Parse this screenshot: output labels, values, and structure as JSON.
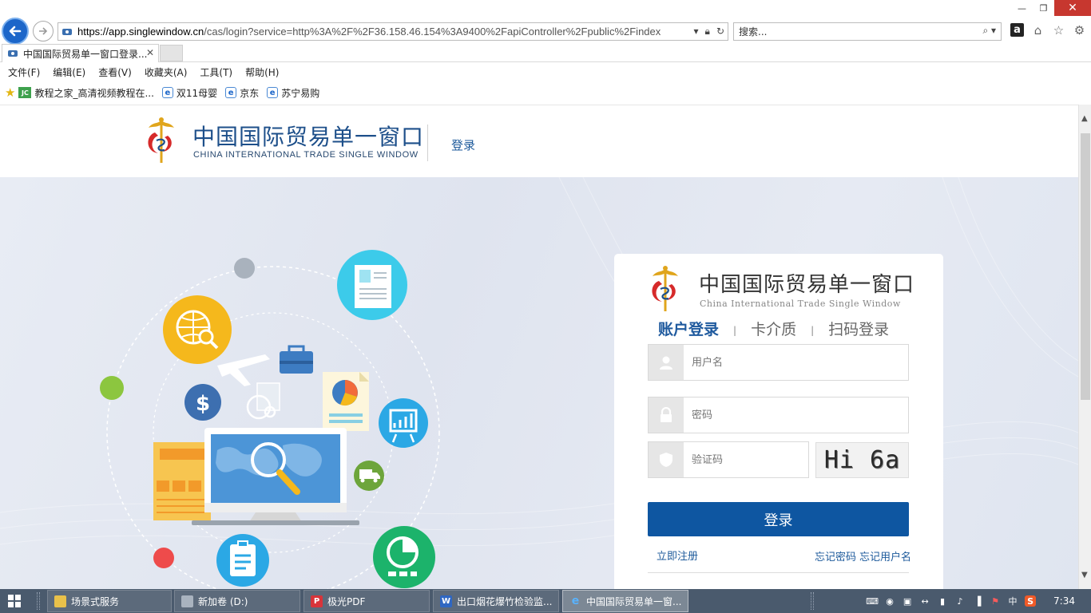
{
  "browser": {
    "url_host": "https://app.singlewindow.cn",
    "url_rest": "/cas/login?service=http%3A%2F%2F36.158.46.154%3A9400%2FapiController%2Fpublic%2Findex",
    "search_placeholder": "搜索...",
    "tab_title": "中国国际贸易单一窗口登录...",
    "menu": [
      "文件(F)",
      "编辑(E)",
      "查看(V)",
      "收藏夹(A)",
      "工具(T)",
      "帮助(H)"
    ],
    "favorites": [
      {
        "label": "教程之家_高清视频教程在...",
        "icon": "jc-icon"
      },
      {
        "label": "双11母婴",
        "icon": "ie-page-icon"
      },
      {
        "label": "京东",
        "icon": "ie-page-icon"
      },
      {
        "label": "苏宁易购",
        "icon": "ie-page-icon"
      }
    ]
  },
  "header": {
    "logo_cn": "中国国际贸易单一窗口",
    "logo_en": "CHINA INTERNATIONAL TRADE SINGLE WINDOW",
    "login_link": "登录"
  },
  "panel": {
    "logo_cn": "中国国际贸易单一窗口",
    "logo_en": "China International Trade Single Window",
    "tabs": [
      {
        "label": "账户登录",
        "active": true
      },
      {
        "label": "卡介质",
        "active": false
      },
      {
        "label": "扫码登录",
        "active": false
      }
    ],
    "tab_divider": "|",
    "username_placeholder": "用户名",
    "password_placeholder": "密码",
    "captcha_placeholder": "验证码",
    "captcha_text": "Hi 6a",
    "login_button": "登录",
    "register_link": "立即注册",
    "forgot_password": "忘记密码",
    "forgot_username": "忘记用户名"
  },
  "taskbar": {
    "tasks": [
      {
        "label": "场景式服务",
        "icon": "folder-icon",
        "active": false
      },
      {
        "label": "新加卷 (D:)",
        "icon": "drive-icon",
        "active": false
      },
      {
        "label": "极光PDF",
        "icon": "pdf-icon",
        "active": false
      },
      {
        "label": "出口烟花爆竹检验监...",
        "icon": "word-icon",
        "active": false
      },
      {
        "label": "中国国际贸易单一窗...",
        "icon": "ie-icon",
        "active": true
      }
    ],
    "ime": "中",
    "clock": "7:34"
  },
  "colors": {
    "brand_blue": "#0e56a1",
    "link_blue": "#1d5a9b",
    "taskbar": "#4a5a6d",
    "close_red": "#c7372f"
  }
}
